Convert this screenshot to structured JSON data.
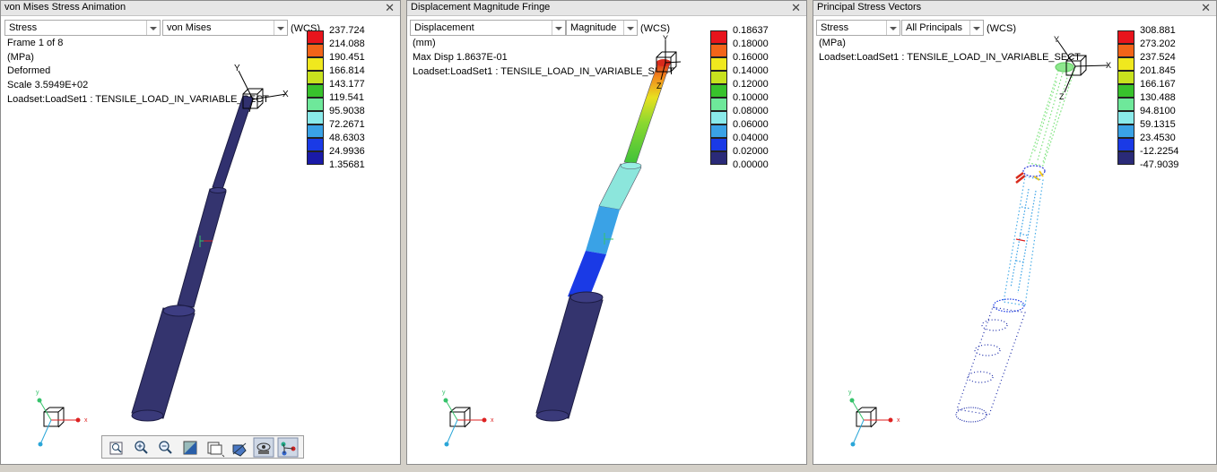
{
  "panels": [
    {
      "title": "von Mises Stress Animation",
      "dropdown1": "Stress",
      "dropdown2": "von Mises",
      "csys": "(WCS)",
      "info": [
        "Frame 1 of 8",
        "(MPa)",
        "Deformed",
        "Scale  3.5949E+02",
        "Loadset:LoadSet1 :  TENSILE_LOAD_IN_VARIABLE_SECT"
      ],
      "legend": [
        "237.724",
        "214.088",
        "190.451",
        "166.814",
        "143.177",
        "119.541",
        "95.9038",
        "72.2671",
        "48.6303",
        "24.9936",
        "1.35681"
      ]
    },
    {
      "title": "Displacement Magnitude Fringe",
      "dropdown1": "Displacement",
      "dropdown2": "Magnitude",
      "csys": "(WCS)",
      "info": [
        "(mm)",
        "Max Disp  1.8637E-01",
        "Loadset:LoadSet1 :  TENSILE_LOAD_IN_VARIABLE_SECT"
      ],
      "legend": [
        "0.18637",
        "0.18000",
        "0.16000",
        "0.14000",
        "0.12000",
        "0.10000",
        "0.08000",
        "0.06000",
        "0.04000",
        "0.02000",
        "0.00000"
      ]
    },
    {
      "title": "Principal Stress Vectors",
      "dropdown1": "Stress",
      "dropdown2": "All Principals",
      "csys": "(WCS)",
      "info": [
        "(MPa)",
        "Loadset:LoadSet1 :  TENSILE_LOAD_IN_VARIABLE_SECT"
      ],
      "legend": [
        "308.881",
        "273.202",
        "237.524",
        "201.845",
        "166.167",
        "130.488",
        "94.8100",
        "59.1315",
        "23.4530",
        "-12.2254",
        "-47.9039"
      ]
    }
  ],
  "legend_colors": [
    "#e8141c",
    "#f26419",
    "#f0e81e",
    "#c8e21e",
    "#38c22c",
    "#6ee89a",
    "#8aeaea",
    "#3aa2e6",
    "#1a3ae6",
    "#1a1aa8",
    "#2a2a78"
  ],
  "axis_labels": {
    "x": "x",
    "y": "y",
    "z": "z"
  },
  "toolbar": [
    "refit-icon",
    "zoom-in-icon",
    "zoom-out-icon",
    "shaded-view-icon",
    "saved-views-icon",
    "spin-center-icon",
    "orient-icon",
    "datum-csys-icon"
  ]
}
